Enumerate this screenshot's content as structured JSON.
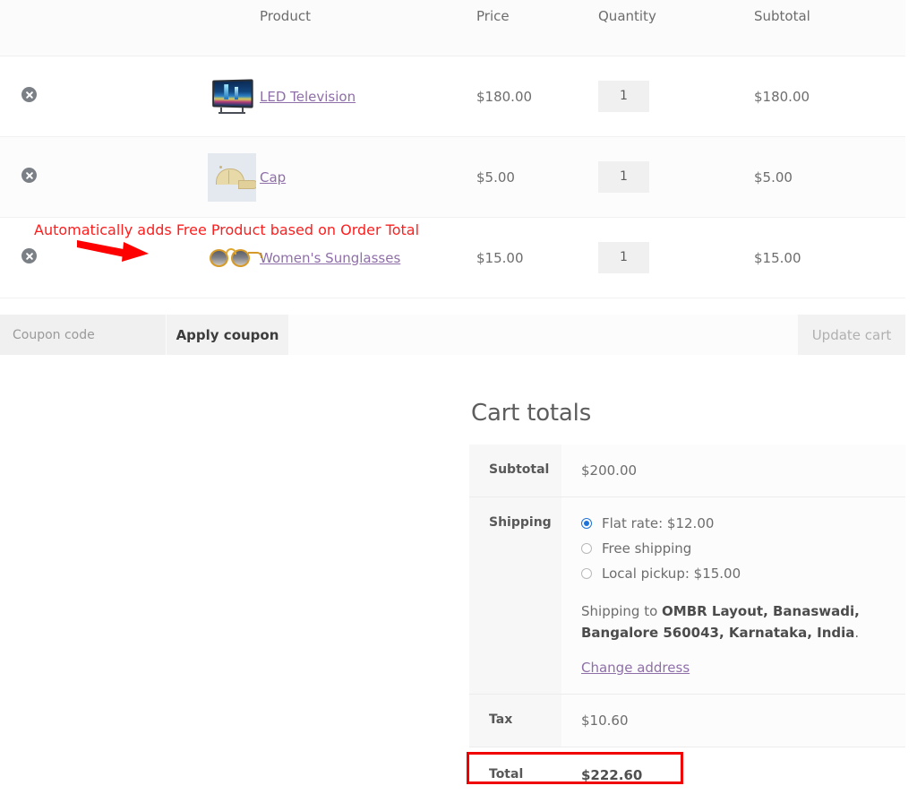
{
  "cart_table": {
    "columns": [
      "",
      "",
      "Product",
      "Price",
      "Quantity",
      "Subtotal"
    ],
    "headers": {
      "product": "Product",
      "price": "Price",
      "quantity": "Quantity",
      "subtotal": "Subtotal"
    },
    "rows": [
      {
        "remove_label": "×",
        "thumb": "led-television-thumbnail",
        "name": "LED Television",
        "price": "$180.00",
        "quantity": "1",
        "subtotal": "$180.00"
      },
      {
        "remove_label": "×",
        "thumb": "cap-thumbnail",
        "name": "Cap",
        "price": "$5.00",
        "quantity": "1",
        "subtotal": "$5.00"
      },
      {
        "remove_label": "×",
        "thumb": "womens-sunglasses-thumbnail",
        "name": "Women's Sunglasses",
        "price": "$15.00",
        "quantity": "1",
        "subtotal": "$15.00"
      }
    ]
  },
  "actions": {
    "coupon_placeholder": "Coupon code",
    "coupon_value": "",
    "apply_coupon_label": "Apply coupon",
    "update_cart_label": "Update cart"
  },
  "cart_totals": {
    "title": "Cart totals",
    "subtotal_label": "Subtotal",
    "subtotal_value": "$200.00",
    "shipping_label": "Shipping",
    "shipping_options": [
      {
        "label": "Flat rate: $12.00",
        "selected": true
      },
      {
        "label": "Free shipping",
        "selected": false
      },
      {
        "label": "Local pickup: $15.00",
        "selected": false
      }
    ],
    "shipping_to_prefix": "Shipping to ",
    "shipping_to_address": "OMBR Layout, Banaswadi, Bangalore 560043, Karnataka, India",
    "shipping_to_suffix": ".",
    "change_address_label": "Change address",
    "tax_label": "Tax",
    "tax_value": "$10.60",
    "total_label": "Total",
    "total_value": "$222.60"
  },
  "annotations": {
    "free_product_note": "Automatically adds Free Product based on Order Total",
    "arrow_color": "#ff0000",
    "highlight_color": "#f00000",
    "note_color": "#ff1d1d"
  },
  "theme": {
    "link_color": "#8f6fa8",
    "radio_accent": "#1e73d8",
    "text_color": "#6d6d6d"
  }
}
